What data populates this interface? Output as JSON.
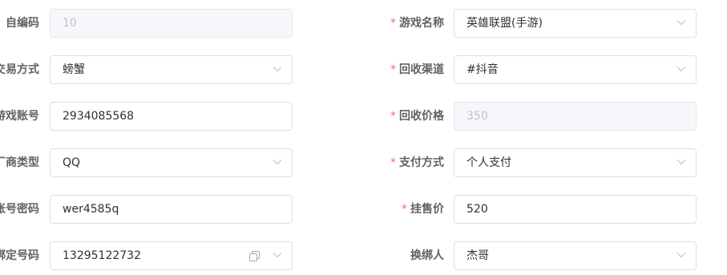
{
  "rows": [
    {
      "left": {
        "label": "自编码",
        "value": "10",
        "required": false
      },
      "right": {
        "label": "游戏名称",
        "value": "英雄联盟(手游)",
        "required": true
      }
    },
    {
      "left": {
        "label": "交易方式",
        "value": "螃蟹",
        "required": false
      },
      "right": {
        "label": "回收渠道",
        "value": "#抖音",
        "required": true
      }
    },
    {
      "left": {
        "label": "游戏账号",
        "value": "2934085568",
        "required": false
      },
      "right": {
        "label": "回收价格",
        "value": "350",
        "required": true
      }
    },
    {
      "left": {
        "label": "厂商类型",
        "value": "QQ",
        "required": false
      },
      "right": {
        "label": "支付方式",
        "value": "个人支付",
        "required": true
      }
    },
    {
      "left": {
        "label": "账号密码",
        "value": "wer4585q",
        "required": false
      },
      "right": {
        "label": "挂售价",
        "value": "520",
        "required": true
      }
    },
    {
      "left": {
        "label": "绑定号码",
        "value": "13295122732",
        "required": false
      },
      "right": {
        "label": "换绑人",
        "value": "杰哥",
        "required": false
      }
    }
  ],
  "required_mark": "*",
  "icons": {
    "dropdown": "chevron-down-icon",
    "copy": "copy-icon"
  }
}
